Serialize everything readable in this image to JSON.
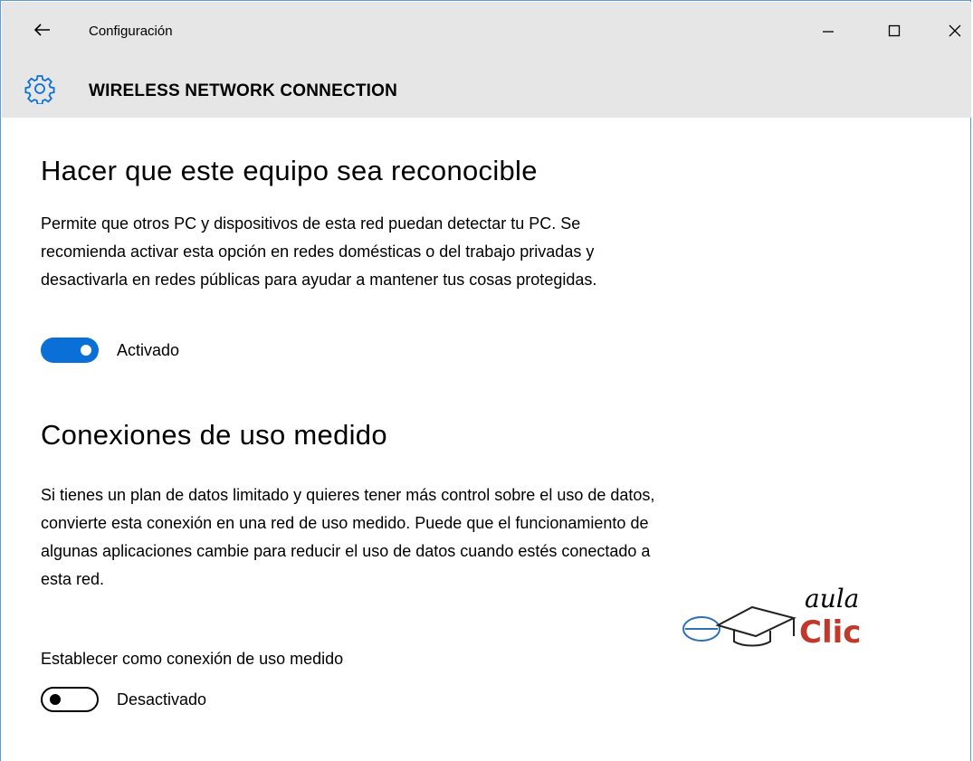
{
  "window": {
    "app_title": "Configuración"
  },
  "header": {
    "title": "WIRELESS NETWORK CONNECTION"
  },
  "sections": [
    {
      "title": "Hacer que este equipo sea reconocible",
      "description": "Permite que otros PC y dispositivos de esta red puedan detectar tu PC. Se recomienda activar esta opción en redes domésticas o del trabajo privadas y desactivarla en redes públicas para ayudar a mantener tus cosas protegidas.",
      "toggle": {
        "state": "on",
        "label": "Activado"
      }
    },
    {
      "title": "Conexiones de uso medido",
      "description": "Si tienes un plan de datos limitado y quieres tener más control sobre el uso de datos, convierte esta conexión en una red de uso medido. Puede que el funcionamiento de algunas aplicaciones cambie para reducir el uso de datos cuando estés conectado a esta red.",
      "setting_label": "Establecer como conexión de uso medido",
      "toggle": {
        "state": "off",
        "label": "Desactivado"
      }
    }
  ],
  "watermark": {
    "line1": "aula",
    "line2": "Clic"
  },
  "colors": {
    "accent": "#0a6fd6",
    "topbar": "#e6e6e6",
    "logo_red": "#c0392b"
  },
  "icons": {
    "back": "back-arrow-icon",
    "gear": "gear-icon",
    "minimize": "minimize-icon",
    "maximize": "maximize-icon",
    "close": "close-icon"
  }
}
